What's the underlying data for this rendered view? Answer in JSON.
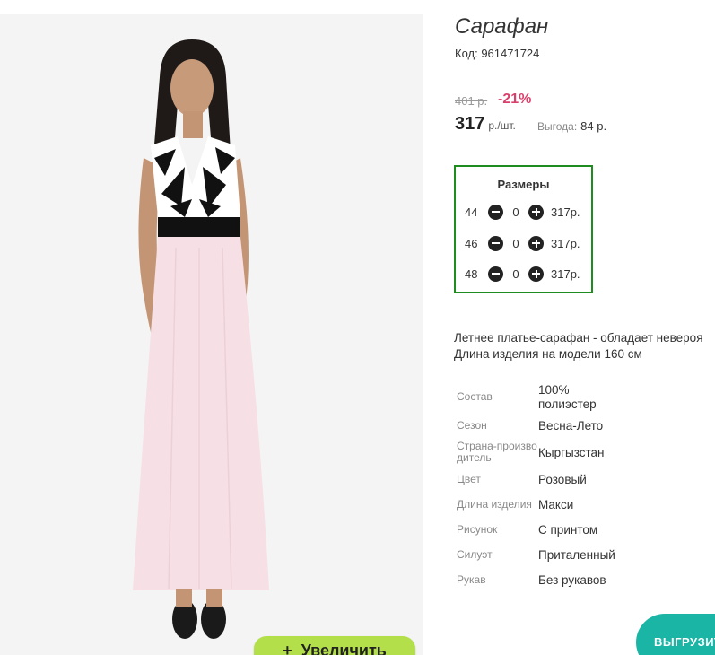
{
  "product": {
    "title": "Сарафан",
    "code": "Код: 961471724",
    "old_price": "401 р.",
    "discount": "-21%",
    "price": "317",
    "price_unit": "р./шт.",
    "benefit_label": "Выгода:",
    "benefit_value": "84 р."
  },
  "image": {
    "zoom_button": "Увеличить",
    "zoom_icon": "plus-icon"
  },
  "sizes": {
    "title": "Размеры",
    "rows": [
      {
        "size": "44",
        "qty": "0",
        "price": "317р."
      },
      {
        "size": "46",
        "qty": "0",
        "price": "317р."
      },
      {
        "size": "48",
        "qty": "0",
        "price": "317р."
      }
    ]
  },
  "description": {
    "line1": "Летнее платье-сарафан - обладает невероя",
    "line2": "Длина изделия на модели 160 см"
  },
  "properties": [
    {
      "label": "Состав",
      "value": "100% полиэстер"
    },
    {
      "label": "Сезон",
      "value": "Весна-Лето"
    },
    {
      "label": "Страна-производитель",
      "value": "Кыргызстан"
    },
    {
      "label": "Цвет",
      "value": "Розовый"
    },
    {
      "label": "Длина изделия",
      "value": "Макси"
    },
    {
      "label": "Рисунок",
      "value": "С принтом"
    },
    {
      "label": "Силуэт",
      "value": "Приталенный"
    },
    {
      "label": "Рукав",
      "value": "Без рукавов"
    }
  ],
  "upload_button": "ВЫГРУЗИТ",
  "colors": {
    "discount": "#d9416c",
    "sizes_border": "#1e8c1e",
    "zoom_button": "#b3e04a",
    "upload_button": "#1bb5a6",
    "dress": "#f6dfe5"
  }
}
